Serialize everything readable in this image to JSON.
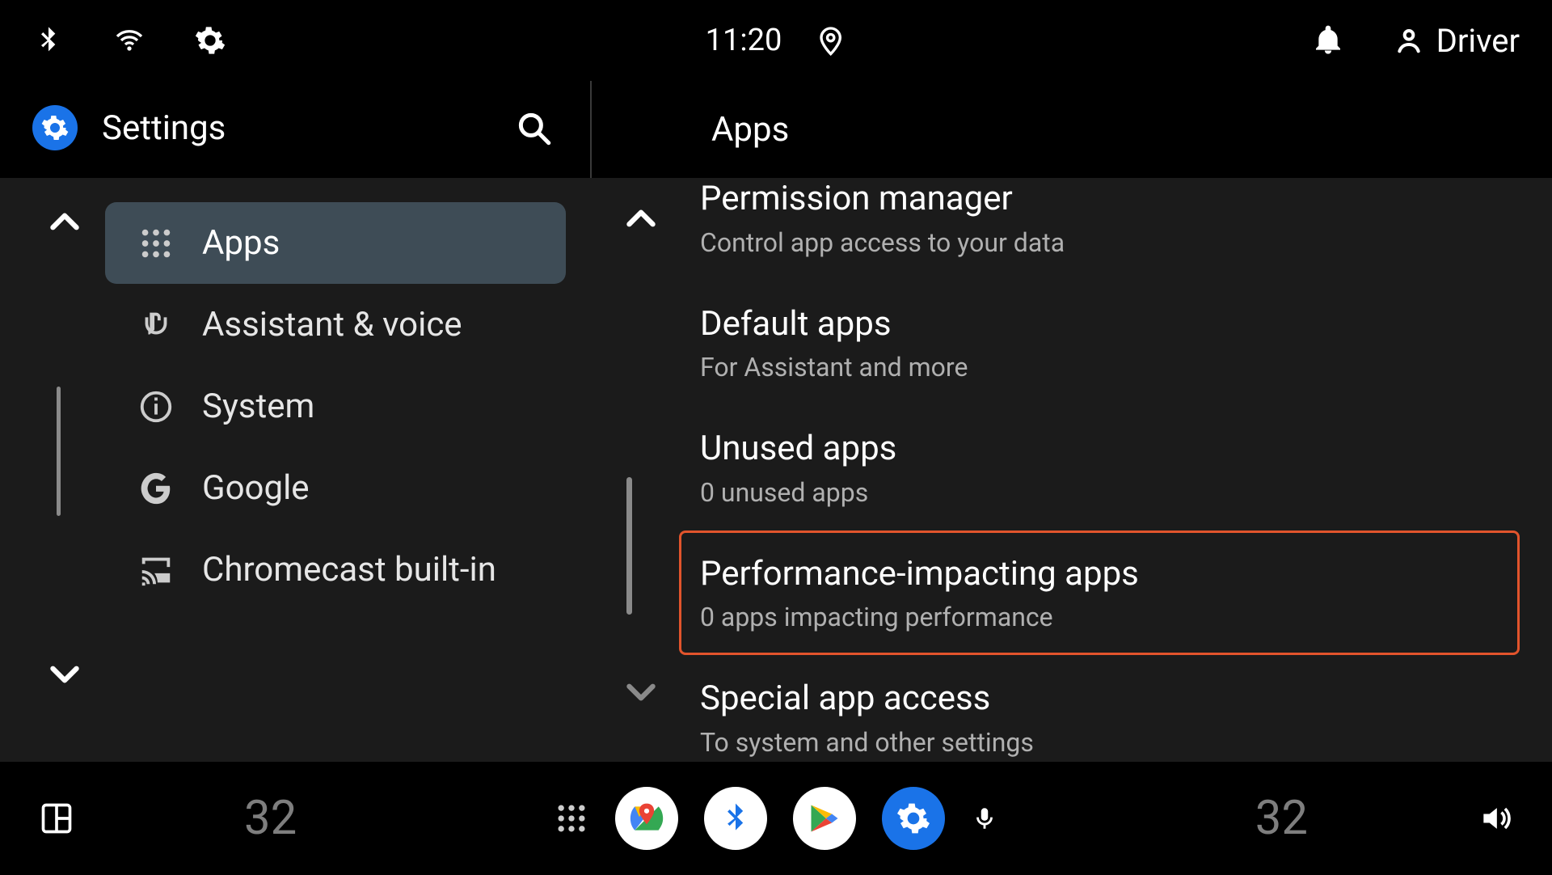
{
  "status": {
    "clock": "11:20",
    "profile_name": "Driver"
  },
  "left": {
    "title": "Settings",
    "items": [
      {
        "id": "apps",
        "label": "Apps",
        "selected": true
      },
      {
        "id": "assistant",
        "label": "Assistant & voice",
        "selected": false
      },
      {
        "id": "system",
        "label": "System",
        "selected": false
      },
      {
        "id": "google",
        "label": "Google",
        "selected": false
      },
      {
        "id": "chromecast",
        "label": "Chromecast built-in",
        "selected": false
      }
    ]
  },
  "right": {
    "title": "Apps",
    "items": [
      {
        "id": "permission-manager",
        "primary": "Permission manager",
        "secondary": "Control app access to your data",
        "highlight": false
      },
      {
        "id": "default-apps",
        "primary": "Default apps",
        "secondary": "For Assistant and more",
        "highlight": false
      },
      {
        "id": "unused-apps",
        "primary": "Unused apps",
        "secondary": "0 unused apps",
        "highlight": false
      },
      {
        "id": "perf-apps",
        "primary": "Performance-impacting apps",
        "secondary": "0 apps impacting performance",
        "highlight": true
      },
      {
        "id": "special-access",
        "primary": "Special app access",
        "secondary": "To system and other settings",
        "highlight": false
      }
    ]
  },
  "bottom": {
    "temp_left": "32",
    "temp_right": "32"
  }
}
